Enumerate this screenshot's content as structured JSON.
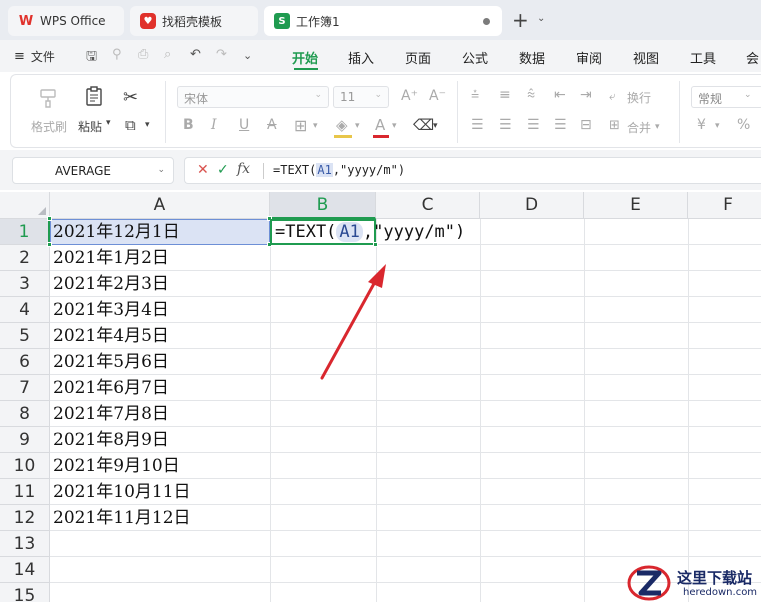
{
  "tabs": [
    {
      "label": "WPS Office",
      "icon": "wps-logo-icon"
    },
    {
      "label": "找稻壳模板",
      "icon": "docer-icon"
    },
    {
      "label": "工作簿1",
      "icon": "sheet-icon",
      "icon_letter": "S",
      "active": true
    }
  ],
  "new_tab_symbol": "+",
  "menu": {
    "file": "文件",
    "items": [
      "开始",
      "插入",
      "页面",
      "公式",
      "数据",
      "审阅",
      "视图",
      "工具",
      "会"
    ],
    "active": "开始"
  },
  "ribbon": {
    "format_painter": "格式刷",
    "paste": "粘贴",
    "font_name": "宋体",
    "font_size": "11",
    "bold": "B",
    "italic": "I",
    "underline": "U",
    "strike": "A",
    "wrap_text": "换行",
    "merge": "合并",
    "number_format": "常规",
    "currency": "¥",
    "percent": "%"
  },
  "formula_bar": {
    "name_box": "AVERAGE",
    "cancel": "✕",
    "confirm": "✓",
    "fx": "fx",
    "formula_prefix": "=TEXT(",
    "formula_ref": "A1",
    "formula_suffix": ",\"yyyy/m\")"
  },
  "columns": [
    "A",
    "B",
    "C",
    "D",
    "E",
    "F"
  ],
  "rows": [
    "1",
    "2",
    "3",
    "4",
    "5",
    "6",
    "7",
    "8",
    "9",
    "10",
    "11",
    "12",
    "13",
    "14",
    "15"
  ],
  "cells_A": [
    "2021年12月1日",
    "2021年1月2日",
    "2021年2月3日",
    "2021年3月4日",
    "2021年4月5日",
    "2021年5月6日",
    "2021年6月7日",
    "2021年7月8日",
    "2021年8月9日",
    "2021年9月10日",
    "2021年10月11日",
    "2021年11月12日"
  ],
  "cell_B1": {
    "prefix": "=TEXT(",
    "ref": "A1",
    "suffix": ",\"yyyy/m\")"
  },
  "watermark": {
    "title": "这里下载站",
    "subtitle": "heredown.com"
  },
  "colors": {
    "accent": "#1f9b50",
    "reference": "#dbe3f4",
    "arrow": "#d9272e"
  }
}
